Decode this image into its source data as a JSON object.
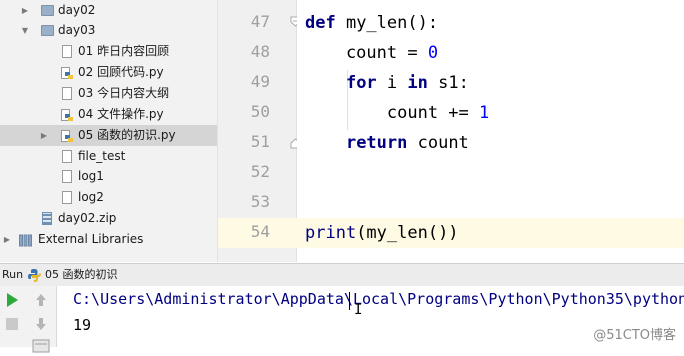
{
  "tree": {
    "items": [
      {
        "label": "day02",
        "kind": "folder",
        "expanded": false
      },
      {
        "label": "day03",
        "kind": "folder",
        "expanded": true
      },
      {
        "label": "01 昨日内容回顾",
        "kind": "file"
      },
      {
        "label": "02 回顾代码.py",
        "kind": "python"
      },
      {
        "label": "03 今日内容大纲",
        "kind": "file"
      },
      {
        "label": "04 文件操作.py",
        "kind": "python"
      },
      {
        "label": "05 函数的初识.py",
        "kind": "python",
        "selected": true
      },
      {
        "label": "file_test",
        "kind": "file"
      },
      {
        "label": "log1",
        "kind": "file"
      },
      {
        "label": "log2",
        "kind": "file"
      },
      {
        "label": "day02.zip",
        "kind": "zip"
      },
      {
        "label": "External Libraries",
        "kind": "libraries"
      }
    ]
  },
  "editor": {
    "line_numbers": [
      "47",
      "48",
      "49",
      "50",
      "51",
      "52",
      "53",
      "54"
    ],
    "current_line": "54"
  },
  "run": {
    "label": "Run",
    "config_name": "05 函数的初识"
  },
  "console": {
    "command": "C:\\Users\\Administrator\\AppData\\Local\\Programs\\Python\\Python35\\python",
    "output": "19"
  },
  "watermark": "@51CTO博客",
  "colors": {
    "keyword": "#000080",
    "number": "#0000ff",
    "run_green": "#2fa83c",
    "current_line": "#fffae3"
  }
}
